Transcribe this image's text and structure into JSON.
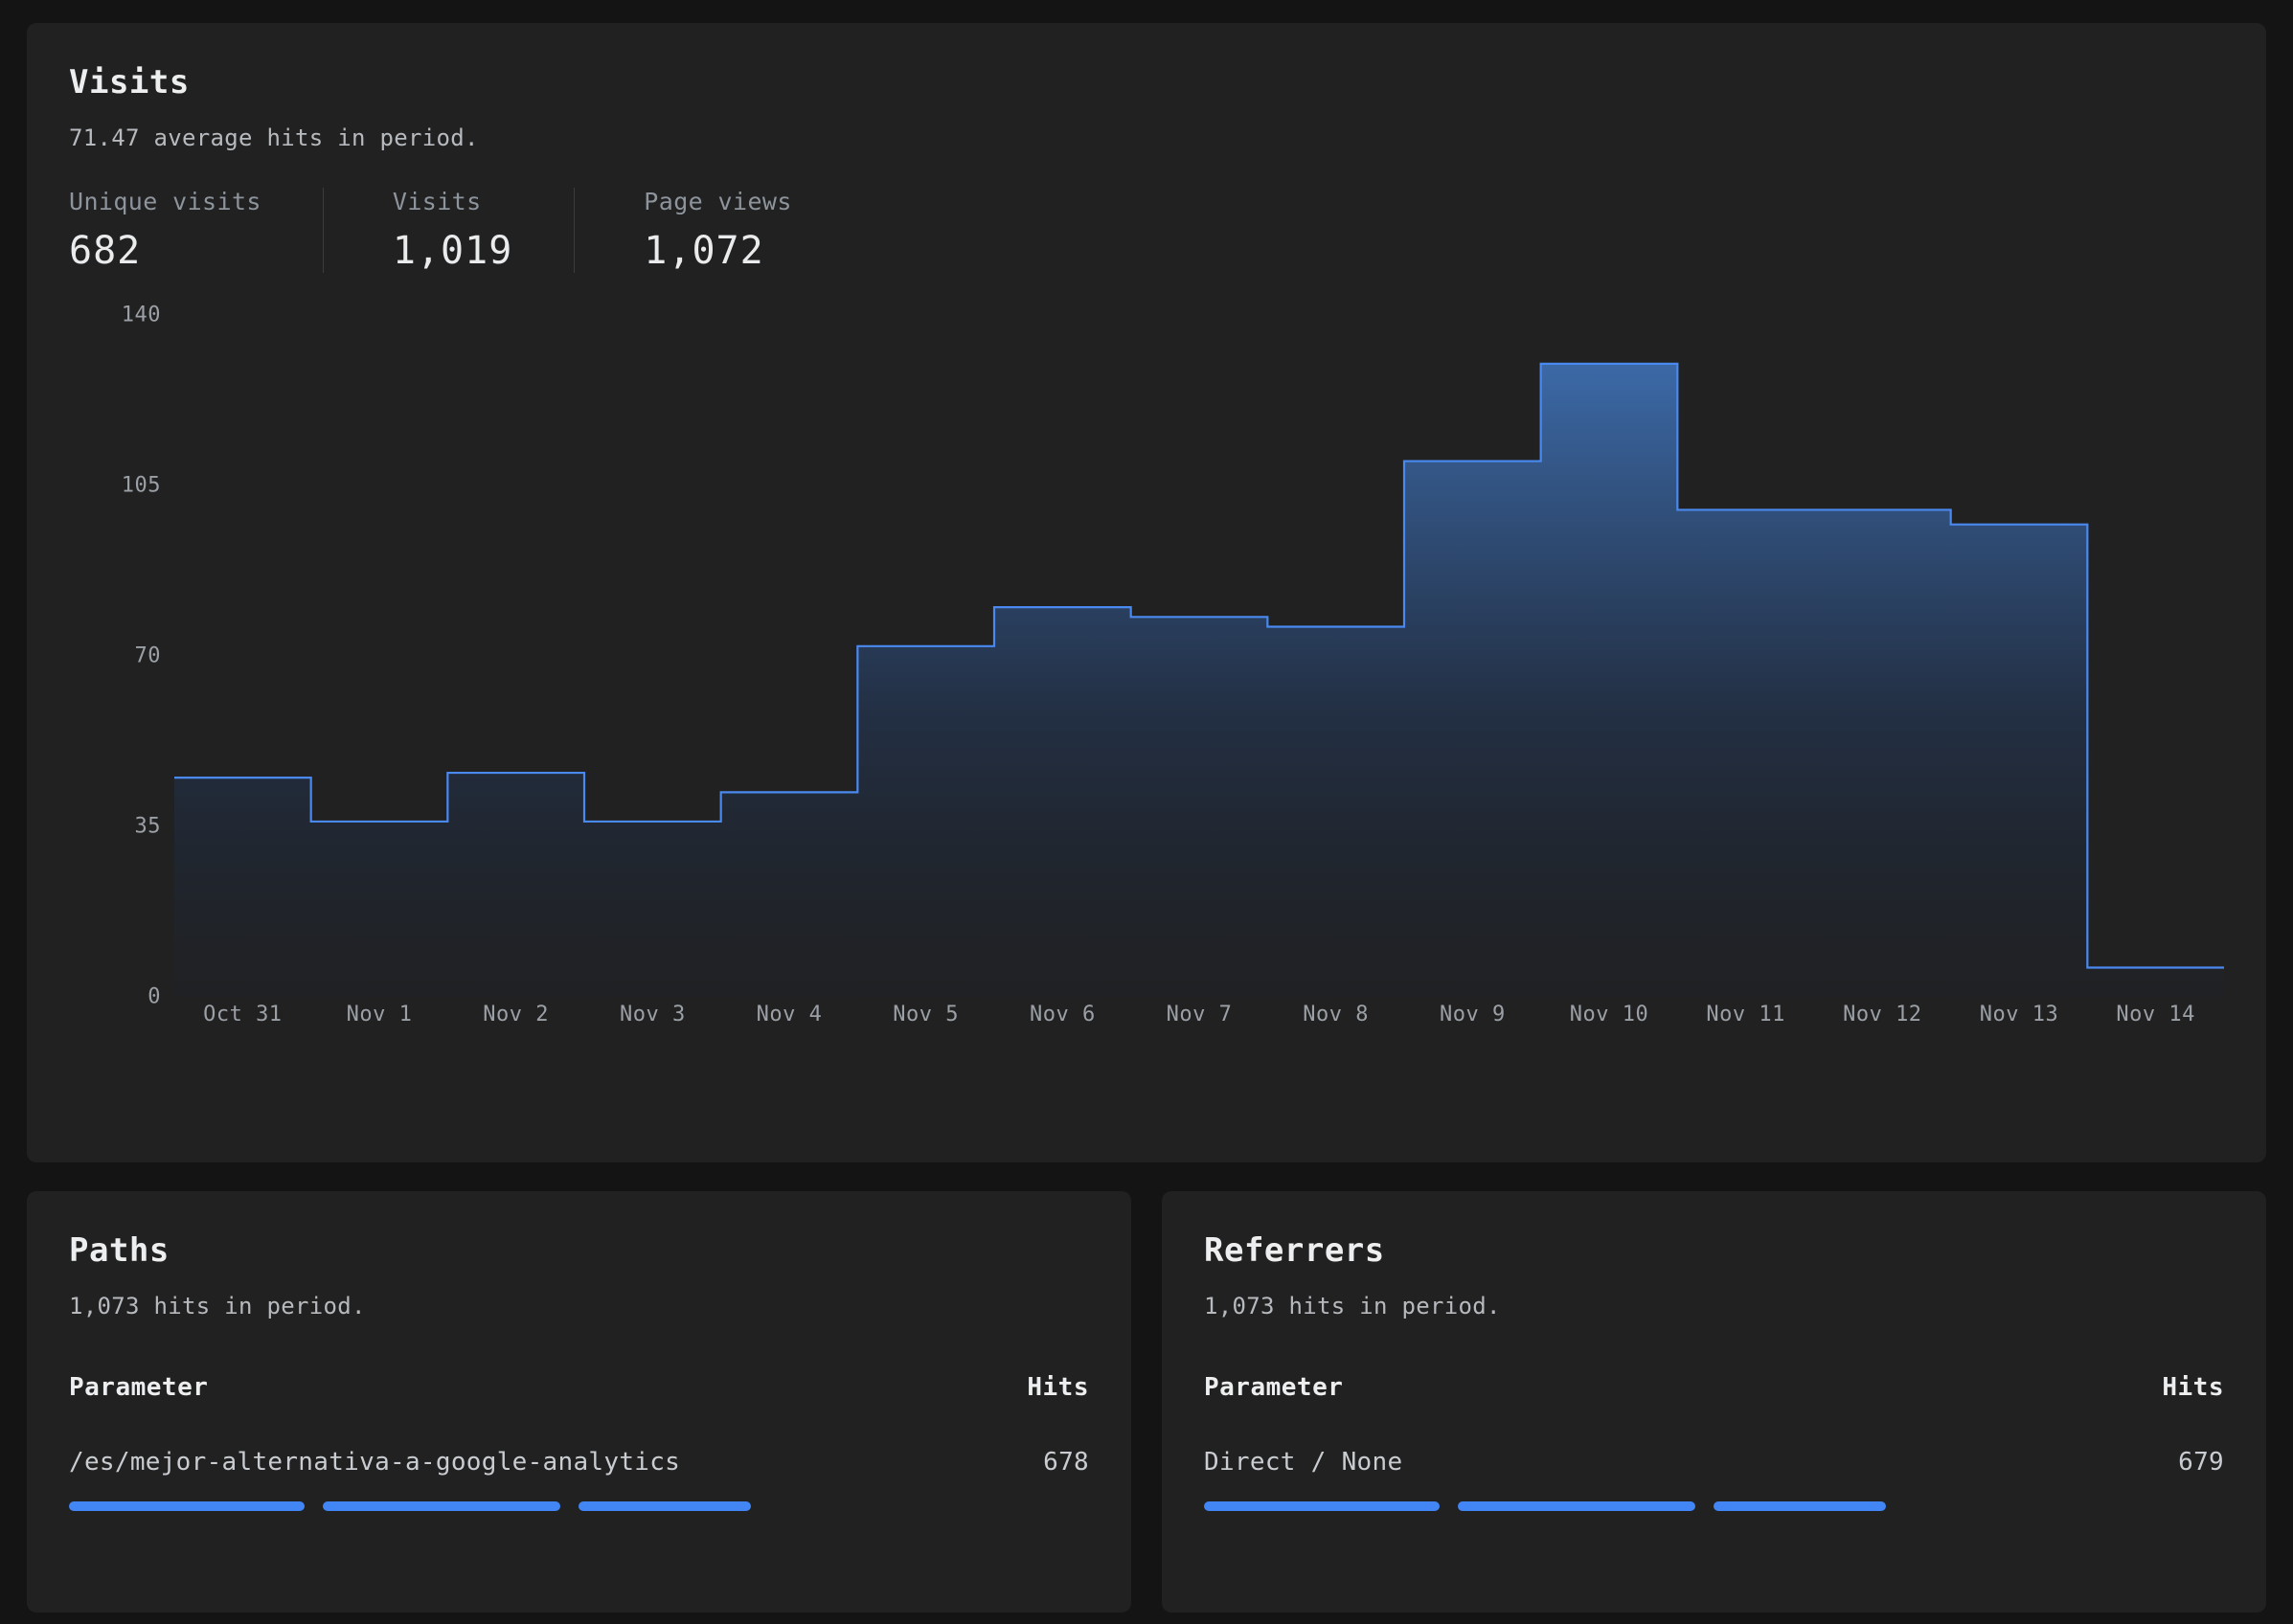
{
  "visits_panel": {
    "title": "Visits",
    "subtitle": "71.47 average hits in period.",
    "stats": [
      {
        "label": "Unique visits",
        "value": "682"
      },
      {
        "label": "Visits",
        "value": "1,019"
      },
      {
        "label": "Page views",
        "value": "1,072"
      }
    ]
  },
  "paths_panel": {
    "title": "Paths",
    "subtitle": "1,073 hits in period.",
    "col_parameter": "Parameter",
    "col_hits": "Hits",
    "rows": [
      {
        "parameter": "/es/mejor-alternativa-a-google-analytics",
        "hits": "678"
      }
    ]
  },
  "referrers_panel": {
    "title": "Referrers",
    "subtitle": "1,073 hits in period.",
    "col_parameter": "Parameter",
    "col_hits": "Hits",
    "rows": [
      {
        "parameter": "Direct / None",
        "hits": "679"
      }
    ]
  },
  "colors": {
    "page_bg": "#141414",
    "card_bg": "#212121",
    "accent_line": "#4a89f0",
    "accent_bar": "#4285f4",
    "text_primary": "#eceef0",
    "text_muted": "#9ba0a6"
  },
  "chart_data": {
    "type": "area",
    "title": "Visits",
    "xlabel": "",
    "ylabel": "",
    "grid": false,
    "legend": "none",
    "step": "pre",
    "ylim": [
      0,
      140
    ],
    "yticks": [
      0,
      35,
      70,
      105,
      140
    ],
    "ytick_labels": [
      "0",
      "35",
      "70",
      "105",
      "140"
    ],
    "categories": [
      "Oct 31",
      "Nov 1",
      "Nov 2",
      "Nov 3",
      "Nov 4",
      "Nov 5",
      "Nov 6",
      "Nov 7",
      "Nov 8",
      "Nov 9",
      "Nov 10",
      "Nov 11",
      "Nov 12",
      "Nov 13",
      "Nov 14"
    ],
    "series": [
      {
        "name": "Hits",
        "values": [
          45,
          36,
          46,
          36,
          42,
          72,
          80,
          78,
          76,
          110,
          130,
          100,
          100,
          97,
          6
        ]
      }
    ]
  }
}
